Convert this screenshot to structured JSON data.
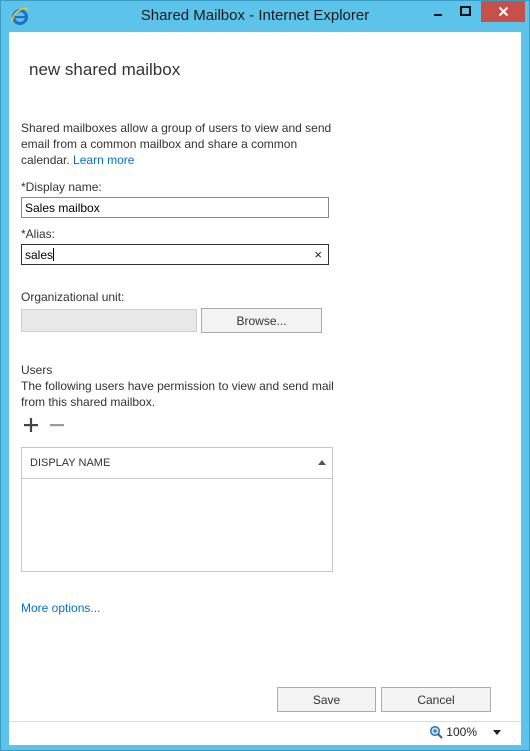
{
  "window": {
    "title": "Shared Mailbox - Internet Explorer"
  },
  "form": {
    "heading": "new shared mailbox",
    "description": "Shared mailboxes allow a group of users to view and send email from a common mailbox and share a common calendar.",
    "learn_more": "Learn more",
    "display_name_label": "*Display name:",
    "display_name_value": "Sales mailbox",
    "alias_label": "*Alias:",
    "alias_value": "sales",
    "alias_clear": "×",
    "ou_label": "Organizational unit:",
    "ou_value": "",
    "browse_label": "Browse...",
    "users_title": "Users",
    "users_description": "The following users have permission to view and send mail from this shared mailbox.",
    "users_grid": {
      "columns": [
        "DISPLAY NAME"
      ],
      "rows": []
    },
    "more_options": "More options...",
    "save_label": "Save",
    "cancel_label": "Cancel"
  },
  "statusbar": {
    "zoom": "100%"
  },
  "colors": {
    "frame": "#5cc4eb",
    "close_button": "#c7504b",
    "link": "#0072c6"
  }
}
